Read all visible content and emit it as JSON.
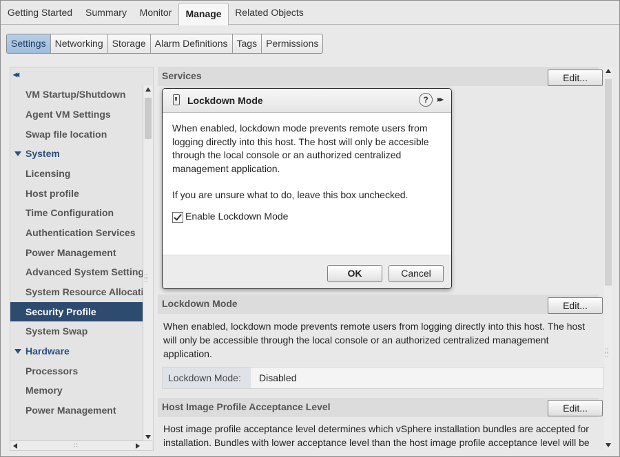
{
  "top_tabs": [
    "Getting Started",
    "Summary",
    "Monitor",
    "Manage",
    "Related Objects"
  ],
  "sub_tabs": [
    "Settings",
    "Networking",
    "Storage",
    "Alarm Definitions",
    "Tags",
    "Permissions"
  ],
  "nav": {
    "collapse": "◂◂",
    "items": [
      {
        "label": "VM Startup/Shutdown",
        "type": "item"
      },
      {
        "label": "Agent VM Settings",
        "type": "item"
      },
      {
        "label": "Swap file location",
        "type": "item"
      },
      {
        "label": "System",
        "type": "group"
      },
      {
        "label": "Licensing",
        "type": "item"
      },
      {
        "label": "Host profile",
        "type": "item"
      },
      {
        "label": "Time Configuration",
        "type": "item"
      },
      {
        "label": "Authentication Services",
        "type": "item"
      },
      {
        "label": "Power Management",
        "type": "item"
      },
      {
        "label": "Advanced System Settings",
        "type": "item"
      },
      {
        "label": "System Resource Allocation",
        "type": "item"
      },
      {
        "label": "Security Profile",
        "type": "item",
        "selected": true
      },
      {
        "label": "System Swap",
        "type": "item"
      },
      {
        "label": "Hardware",
        "type": "group"
      },
      {
        "label": "Processors",
        "type": "item"
      },
      {
        "label": "Memory",
        "type": "item"
      },
      {
        "label": "Power Management",
        "type": "item"
      }
    ]
  },
  "sections": {
    "services": {
      "title": "Services",
      "edit": "Edit..."
    },
    "lockdown": {
      "title": "Lockdown Mode",
      "edit": "Edit...",
      "description": "When enabled, lockdown mode prevents remote users from logging directly into this host. The host will only be accessible through the local console or an authorized centralized management application.",
      "key": "Lockdown Mode:",
      "value": "Disabled"
    },
    "acceptance": {
      "title": "Host Image Profile Acceptance Level",
      "edit": "Edit...",
      "description": "Host image profile acceptance level determines which vSphere installation bundles are accepted for installation. Bundles with lower acceptance level than the host image profile acceptance level will be"
    }
  },
  "dialog": {
    "title": "Lockdown Mode",
    "help": "?",
    "expand": "▸▸",
    "body": "When enabled, lockdown mode prevents remote users from logging directly into this host. The host will only be accesible through the local console or an authorized centralized management application.",
    "note": "If you are unsure what to do, leave this box unchecked.",
    "checkbox_label": "Enable Lockdown Mode",
    "checkbox_checked": true,
    "ok": "OK",
    "cancel": "Cancel"
  },
  "colors": {
    "selected_nav": "#2d4a6f",
    "active_subtab": "#a9c4de",
    "group_label": "#2a4f7a"
  }
}
